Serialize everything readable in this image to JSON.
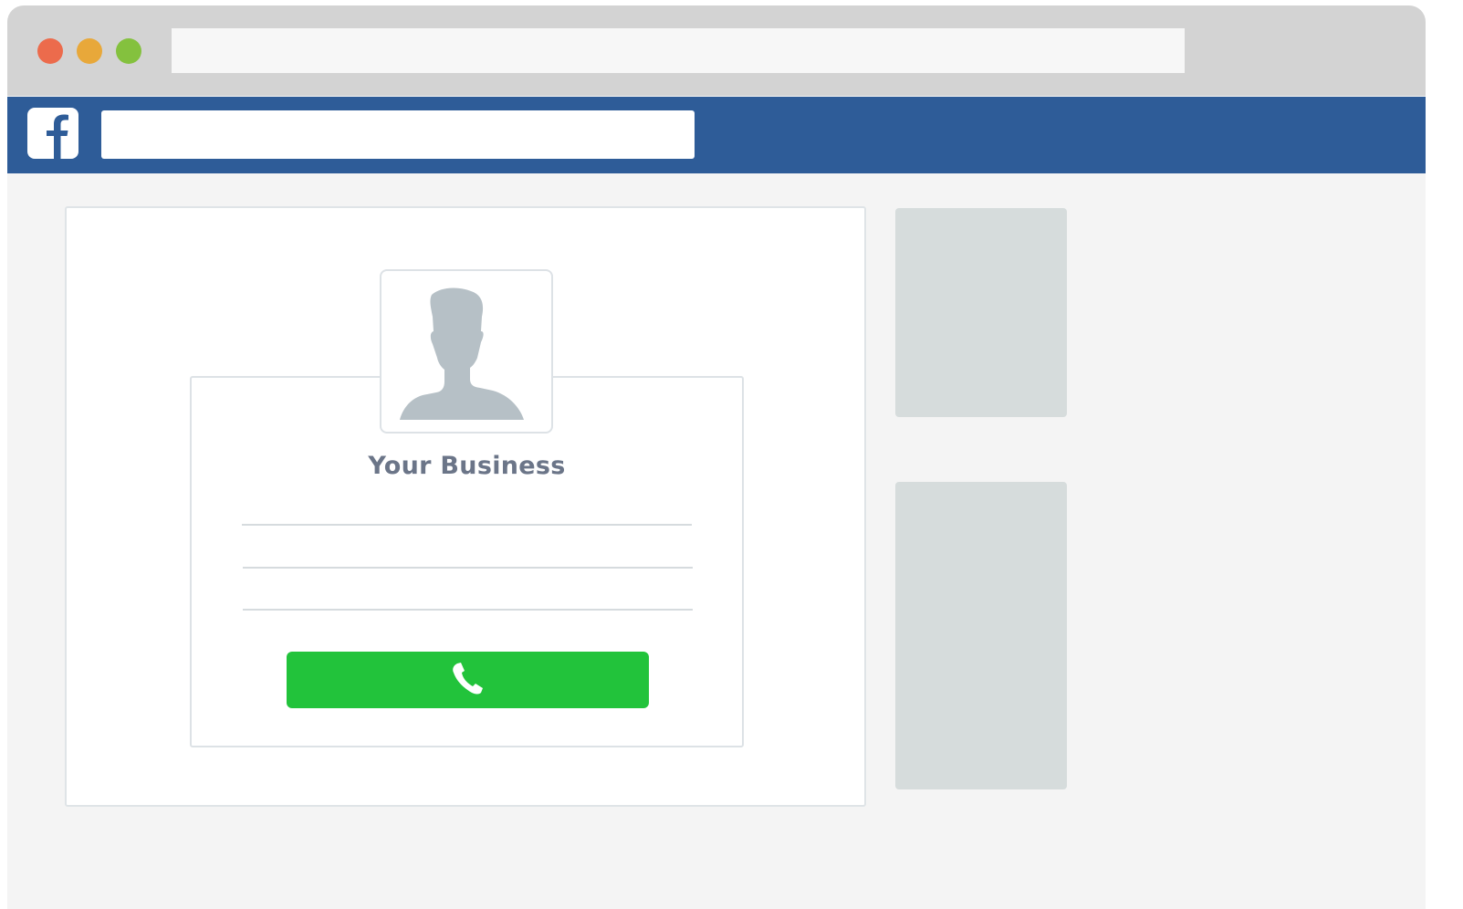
{
  "browser": {
    "address_bar": {
      "value": "",
      "placeholder": ""
    },
    "traffic_lights": [
      {
        "name": "close",
        "color": "#ec6b4c"
      },
      {
        "name": "minimize",
        "color": "#e8a83a"
      },
      {
        "name": "maximize",
        "color": "#84c13e"
      }
    ]
  },
  "header": {
    "logo_icon": "facebook-f-logo",
    "brand_color": "#2e5c98",
    "search": {
      "value": "",
      "placeholder": ""
    }
  },
  "business_card": {
    "avatar_icon": "person-silhouette",
    "name": "Your Business",
    "call_button": {
      "icon": "phone-handset",
      "color": "#22c33b"
    }
  }
}
